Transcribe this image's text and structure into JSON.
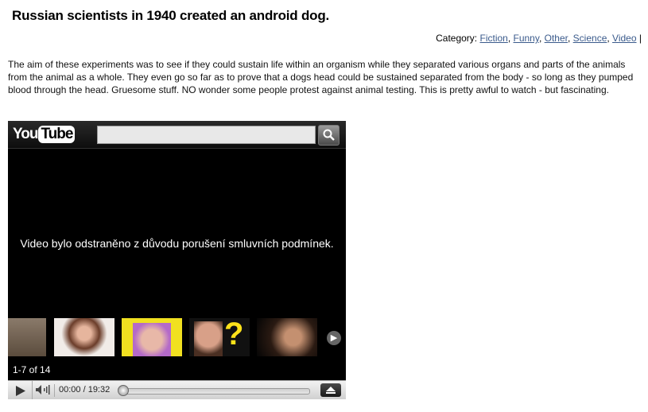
{
  "post": {
    "title": "Russian scientists in 1940 created an android dog.",
    "category_label": "Category:",
    "categories": [
      "Fiction",
      "Funny",
      "Other",
      "Science",
      "Video"
    ],
    "separator": "|",
    "description": "The aim of these experiments was to see if they could sustain life within an organism while they separated various organs and parts of the animals from the animal as a whole. They even go so far as to prove that a dogs head could be sustained separated from the body - so long as they pumped blood through the head. Gruesome stuff. NO wonder some people protest against animal testing. This is pretty awful to watch - but fascinating."
  },
  "player": {
    "logo_you": "You",
    "logo_tube": "Tube",
    "search_placeholder": "",
    "message": "Video bylo odstraněno z důvodu porušení smluvních podmínek.",
    "related_count": "1-7 of 14",
    "time": "00:00 / 19:32",
    "progress": 0
  },
  "colors": {
    "link": "#3b5b8c",
    "player_bg": "#000000"
  }
}
